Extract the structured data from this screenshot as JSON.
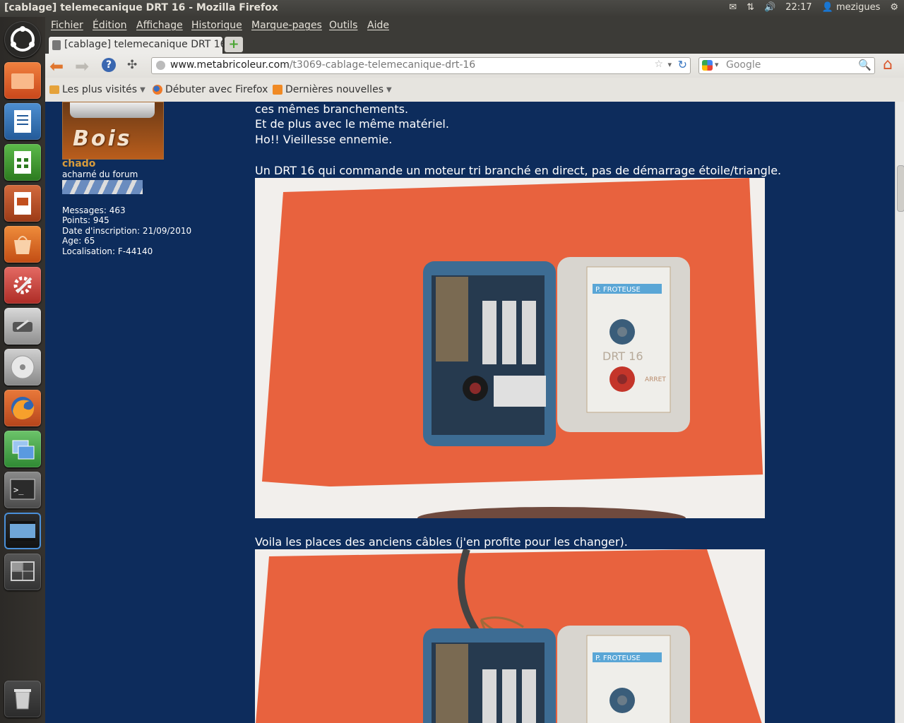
{
  "window": {
    "title": "[cablage] telemecanique DRT 16 - Mozilla Firefox"
  },
  "indicators": {
    "time": "22:17",
    "user": "mezigues"
  },
  "menu": [
    "Fichier",
    "Édition",
    "Affichage",
    "Historique",
    "Marque-pages",
    "Outils",
    "Aide"
  ],
  "tab": {
    "label": "[cablage] telemecanique DRT 16"
  },
  "url": {
    "domain": "www.metabricoleur.com",
    "path": "/t3069-cablage-telemecanique-drt-16"
  },
  "search": {
    "placeholder": "Google"
  },
  "bookmarks": [
    "Les plus visités",
    "Débuter avec Firefox",
    "Dernières nouvelles"
  ],
  "author": {
    "avatar_text": "Bois",
    "name": "chado",
    "rank": "acharné du forum",
    "stats": [
      "Messages: 463",
      "Points: 945",
      "Date d'inscription: 21/09/2010",
      "Age: 65",
      "Localisation: F-44140"
    ]
  },
  "post": {
    "lines": [
      "ces mêmes branchements.",
      "Et de plus avec le même matériel.",
      "Ho!! Vieillesse ennemie."
    ],
    "caption1": "Un DRT 16 qui commande un moteur tri branché en direct, pas de démarrage étoile/triangle.",
    "caption2": "Voila les places des anciens câbles (j'en profite pour les changer).",
    "photo_label": "P. FROTEUSE",
    "photo_model": "DRT 16",
    "photo_stop": "ARRET"
  }
}
